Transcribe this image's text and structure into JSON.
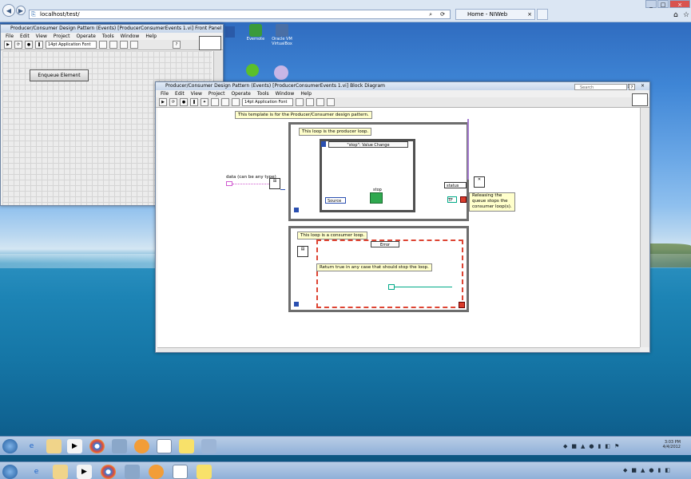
{
  "browser": {
    "address": "localhost/test/",
    "tab_label": "Home - NIWeb"
  },
  "desktop_icons": [
    {
      "label": "Evernote"
    },
    {
      "label": "Oracle VM VirtualBox"
    },
    {
      "label": "Spotify"
    }
  ],
  "front_panel": {
    "title": "Producer/Consumer Design Pattern (Events) [ProducerConsumerEvents 1.vi] Front Panel",
    "menu": [
      "File",
      "Edit",
      "View",
      "Project",
      "Operate",
      "Tools",
      "Window",
      "Help"
    ],
    "font": "14pt Application Font",
    "button_label": "Enqueue Element"
  },
  "block_diagram": {
    "title": "Producer/Consumer Design Pattern (Events) [ProducerConsumerEvents 1.vi] Block Diagram",
    "menu": [
      "File",
      "Edit",
      "View",
      "Project",
      "Operate",
      "Tools",
      "Window",
      "Help"
    ],
    "font": "14pt Application Font",
    "search_placeholder": "Search",
    "template_note": "This template is for the Producer/Consumer design pattern.",
    "producer_label": "This loop is the producer loop.",
    "event_case": "\"stop\": Value Change",
    "source_label": "Source",
    "stop_label": "stop",
    "data_label": "data (can be any type)",
    "status_label": "status",
    "release_note": "Releasing the queue stops the consumer loop(s).",
    "consumer_label": "This loop is a consumer loop.",
    "error_case": "Error",
    "consumer_note": "Return true in any case that should stop the loop.",
    "tf_label": "TF"
  },
  "tray": {
    "time": "3:03 PM",
    "date": "4/4/2012"
  }
}
